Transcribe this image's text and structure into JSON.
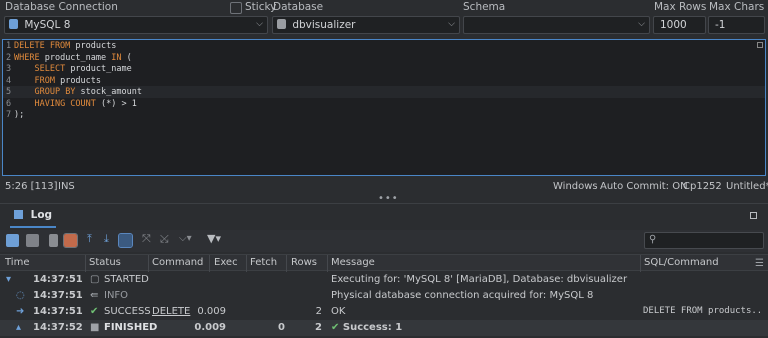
{
  "toolbar": {
    "db_connection_label": "Database Connection",
    "sticky_label": "Sticky",
    "database_label": "Database",
    "schema_label": "Schema",
    "max_rows_label": "Max Rows",
    "max_chars_label": "Max Chars",
    "connection_value": "MySQL 8",
    "database_value": "dbvisualizer",
    "schema_value": "",
    "max_rows_value": "1000",
    "max_chars_value": "-1"
  },
  "editor": {
    "lines": [
      {
        "num": "1",
        "parts": [
          [
            "kw",
            "DELETE FROM"
          ],
          [
            "",
            "products"
          ]
        ]
      },
      {
        "num": "2",
        "parts": [
          [
            "kw",
            "WHERE"
          ],
          [
            "",
            "product_name "
          ],
          [
            "kw",
            "IN"
          ],
          [
            "",
            "("
          ]
        ]
      },
      {
        "num": "3",
        "parts": [
          [
            "",
            "    "
          ],
          [
            "kw",
            "SELECT"
          ],
          [
            "",
            "product_name"
          ]
        ]
      },
      {
        "num": "4",
        "parts": [
          [
            "",
            "    "
          ],
          [
            "kw",
            "FROM"
          ],
          [
            "",
            "products"
          ]
        ]
      },
      {
        "num": "5",
        "parts": [
          [
            "",
            "    "
          ],
          [
            "kw",
            "GROUP BY"
          ],
          [
            "",
            "stock_amount"
          ]
        ]
      },
      {
        "num": "6",
        "parts": [
          [
            "",
            "    "
          ],
          [
            "kw",
            "HAVING COUNT"
          ],
          [
            "",
            "(*) > 1"
          ]
        ]
      },
      {
        "num": "7",
        "parts": [
          [
            "",
            ");"
          ]
        ]
      }
    ]
  },
  "status": {
    "position": "5:26 [113]",
    "mode": "INS",
    "line_endings": "Windows",
    "auto_commit": "Auto Commit: ON",
    "encoding": "Cp1252",
    "file": "Untitled*"
  },
  "log": {
    "tab_label": "Log",
    "columns": [
      "Time",
      "Status",
      "Command",
      "Exec",
      "Fetch",
      "Rows",
      "Message",
      "SQL/Command"
    ],
    "rows": [
      {
        "time": "14:37:51",
        "status": "STARTED",
        "command": "",
        "exec": "",
        "fetch": "",
        "rows": "",
        "message": "Executing for: 'MySQL 8' [MariaDB], Database: dbvisualizer",
        "sql": "",
        "bold": false,
        "status_color": "#c8cacd"
      },
      {
        "time": "14:37:51",
        "status": "INFO",
        "command": "",
        "exec": "",
        "fetch": "",
        "rows": "",
        "message": "Physical database connection acquired for: MySQL 8",
        "sql": "",
        "bold": false,
        "status_color": "#9a9da2"
      },
      {
        "time": "14:37:51",
        "status": "SUCCESS",
        "command": "DELETE",
        "exec": "0.009",
        "fetch": "",
        "rows": "2",
        "message": "OK",
        "sql": "DELETE FROM products..",
        "bold": false,
        "status_color": "#c8cacd"
      },
      {
        "time": "14:37:52",
        "status": "FINISHED",
        "command": "",
        "exec": "0.009",
        "fetch": "0",
        "rows": "2",
        "message": "Success: 1",
        "sql": "",
        "bold": true,
        "status_color": "#dfe1e4"
      }
    ]
  },
  "colors": {
    "accent": "#4a86c7",
    "keyword": "#e08a3c",
    "success": "#6fbf73"
  }
}
